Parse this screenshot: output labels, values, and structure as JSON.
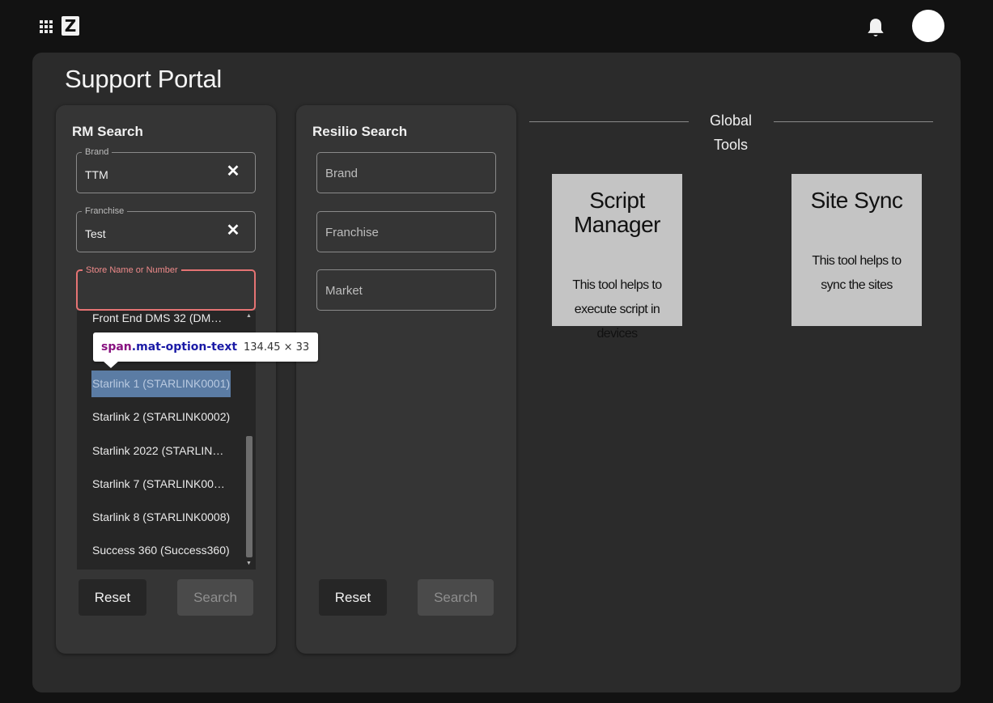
{
  "header": {
    "logo_letter": "Z",
    "icons": [
      "apps-icon",
      "bell-icon",
      "avatar"
    ]
  },
  "page_title": "Support Portal",
  "rm_search": {
    "title": "RM Search",
    "brand": {
      "label": "Brand",
      "value": "TTM"
    },
    "franchise": {
      "label": "Franchise",
      "value": "Test"
    },
    "store": {
      "label": "Store Name or Number",
      "value": ""
    },
    "options": [
      "Front End DMS 32  (DM…",
      "Starlink 1  (STARLINK0001)",
      "Starlink 2  (STARLINK0002)",
      "Starlink 2022  (STARLIN…",
      "Starlink 7  (STARLINK00…",
      "Starlink 8  (STARLINK0008)",
      "Success 360  (Success360)"
    ],
    "reset_label": "Reset",
    "search_label": "Search"
  },
  "resilio_search": {
    "title": "Resilio Search",
    "brand_placeholder": "Brand",
    "franchise_placeholder": "Franchise",
    "market_placeholder": "Market",
    "reset_label": "Reset",
    "search_label": "Search"
  },
  "inspector_tooltip": {
    "tag": "span",
    "selector": ".mat-option-text",
    "dimensions": "134.45 × 33"
  },
  "global_tools": {
    "label": "Global Tools",
    "tools": [
      {
        "title": "Script Manager",
        "description": "This tool helps to execute script in devices"
      },
      {
        "title": "Site Sync",
        "description": "This tool helps to sync the sites"
      }
    ]
  },
  "colors": {
    "background": "#121212",
    "panel": "#2b2b2b",
    "card": "#353535",
    "error_outline": "#e57373",
    "option_highlight": "#5b7ca4",
    "tool_card": "#c4c4c4"
  }
}
